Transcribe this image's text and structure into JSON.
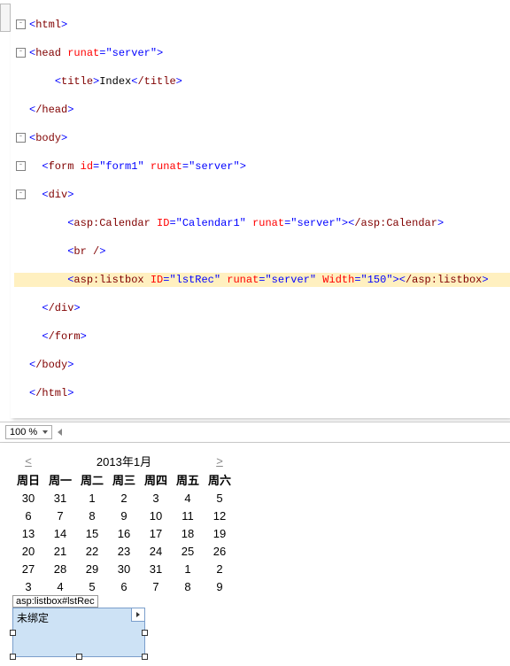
{
  "code": {
    "html_open": "html",
    "head_open": "head",
    "head_runat_attr": "runat",
    "head_runat_val": "\"server\"",
    "title_open": "title",
    "title_text": "Index",
    "title_close": "/title",
    "head_close": "/head",
    "body_open": "body",
    "form_open": "form",
    "form_id_attr": "id",
    "form_id_val": "\"form1\"",
    "form_runat_attr": "runat",
    "form_runat_val": "\"server\"",
    "div_open": "div",
    "cal_open": "asp:Calendar",
    "cal_id_attr": "ID",
    "cal_id_val": "\"Calendar1\"",
    "cal_runat_attr": "runat",
    "cal_runat_val": "\"server\"",
    "cal_close_inline": "/asp:Calendar",
    "br": "br /",
    "lst_open": "asp:listbox",
    "lst_id_attr": "ID",
    "lst_id_val": "\"lstRec\"",
    "lst_runat_attr": "runat",
    "lst_runat_val": "\"server\"",
    "lst_w_attr": "Width",
    "lst_w_val": "\"150\"",
    "lst_close_inline": "/asp:listbox",
    "div_close": "/div",
    "form_close": "/form",
    "body_close": "/body",
    "html_close": "/html"
  },
  "zoom": {
    "value": "100 %"
  },
  "calendar": {
    "prev": "<",
    "title": "2013年1月",
    "next": ">",
    "headers": [
      "周日",
      "周一",
      "周二",
      "周三",
      "周四",
      "周五",
      "周六"
    ],
    "rows": [
      [
        "30",
        "31",
        "1",
        "2",
        "3",
        "4",
        "5"
      ],
      [
        "6",
        "7",
        "8",
        "9",
        "10",
        "11",
        "12"
      ],
      [
        "13",
        "14",
        "15",
        "16",
        "17",
        "18",
        "19"
      ],
      [
        "20",
        "21",
        "22",
        "23",
        "24",
        "25",
        "26"
      ],
      [
        "27",
        "28",
        "29",
        "30",
        "31",
        "1",
        "2"
      ],
      [
        "3",
        "4",
        "5",
        "6",
        "7",
        "8",
        "9"
      ]
    ]
  },
  "designer": {
    "tag_label": "asp:listbox#lstRec",
    "listbox_text": "未绑定"
  }
}
